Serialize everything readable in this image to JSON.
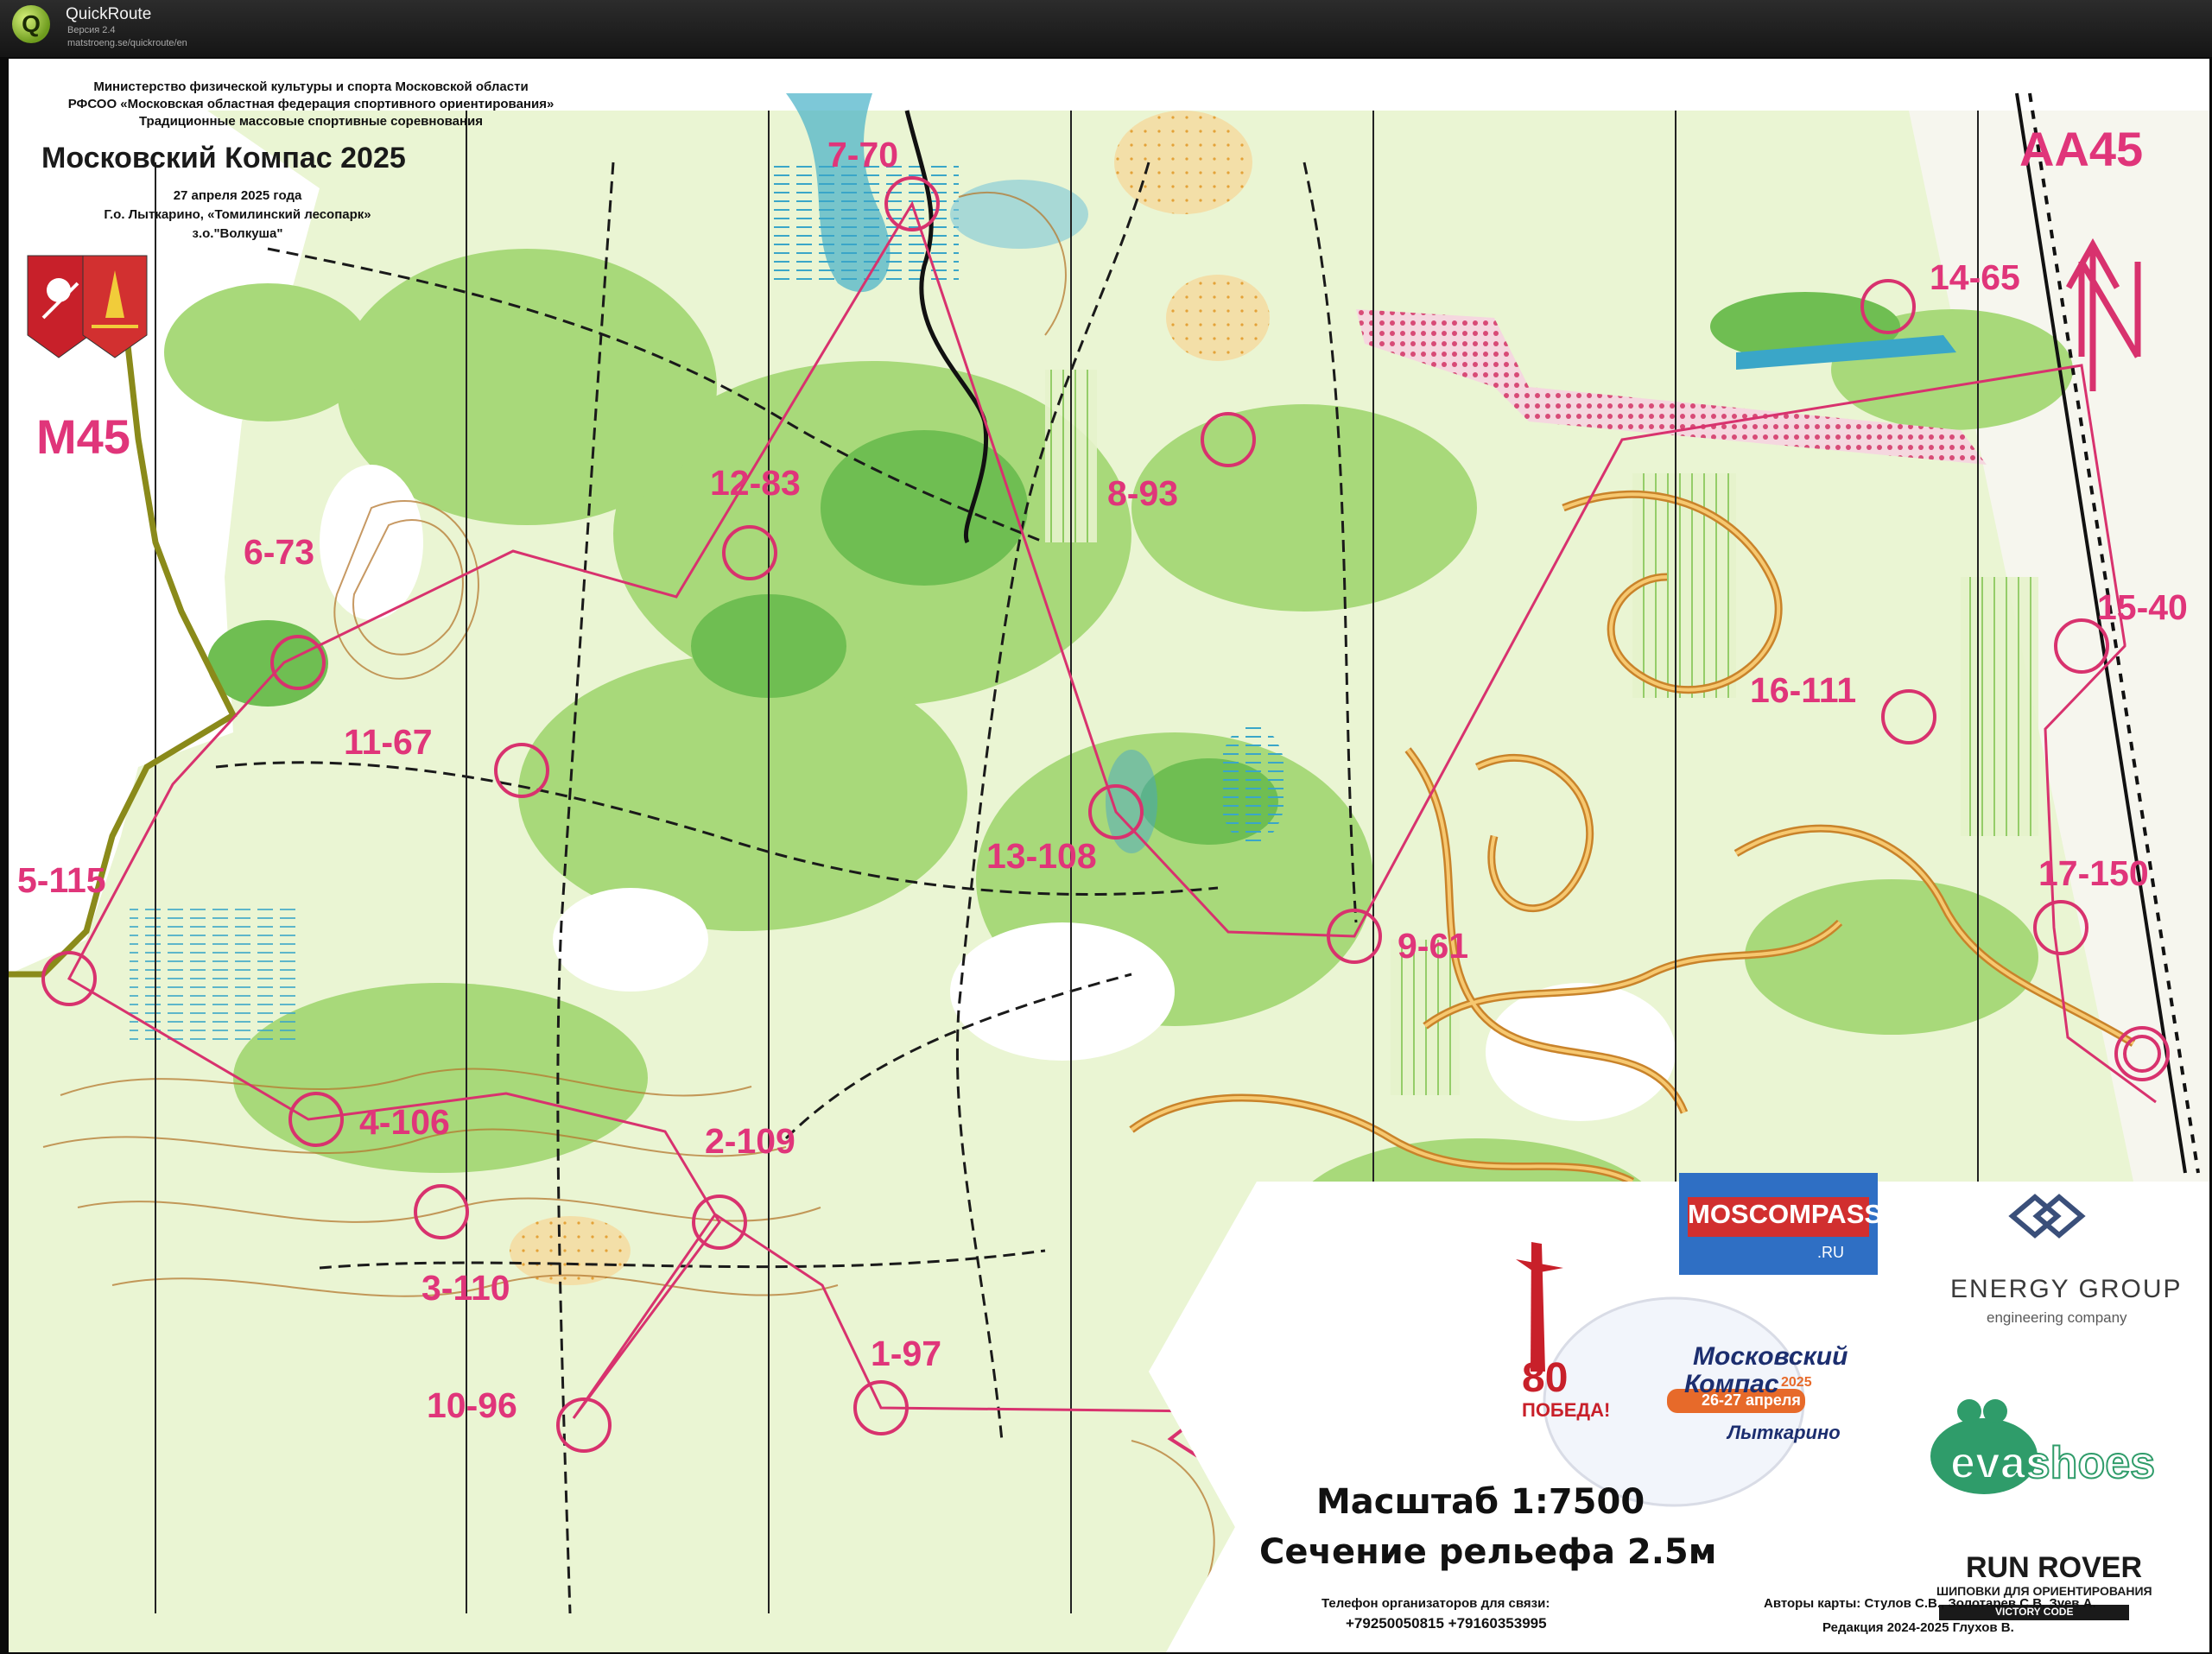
{
  "app": {
    "logo_letter": "Q",
    "name": "QuickRoute",
    "version": "Версия 2.4",
    "url": "matstroeng.se/quickroute/en"
  },
  "header": {
    "line1": "Министерство физической культуры и спорта Московской области",
    "line2": "РФСОО «Московская областная федерация спортивного ориентирования»",
    "line3": "Традиционные массовые спортивные соревнования",
    "title": "Московский Компас 2025",
    "date": "27 апреля 2025 года",
    "place": "Г.о. Лыткарино, «Томилинский лесопарк»",
    "zone": "з.о.\"Волкуша\""
  },
  "classes": {
    "left": "М45",
    "right": "АА45"
  },
  "controls": [
    {
      "label": "1-97"
    },
    {
      "label": "2-109"
    },
    {
      "label": "3-110"
    },
    {
      "label": "4-106"
    },
    {
      "label": "5-115"
    },
    {
      "label": "6-73"
    },
    {
      "label": "7-70"
    },
    {
      "label": "8-93"
    },
    {
      "label": "9-61"
    },
    {
      "label": "10-96"
    },
    {
      "label": "11-67"
    },
    {
      "label": "12-83"
    },
    {
      "label": "13-108"
    },
    {
      "label": "14-65"
    },
    {
      "label": "15-40"
    },
    {
      "label": "16-111"
    },
    {
      "label": "17-150"
    }
  ],
  "scale": {
    "line1": "Масштаб 1:7500",
    "line2": "Сечение рельефа 2.5м"
  },
  "contacts": {
    "label": "Телефон организаторов для связи:",
    "phones": "+79250050815  +79160353995"
  },
  "credits": {
    "authors": "Авторы карты: Стулов С.В., Золотарев С.В, Зуев А.",
    "edition": "Редакция 2024-2025  Глухов В."
  },
  "sponsors": {
    "moscompass": "MOSCOMPASS",
    "moscompass_ru": ".RU",
    "energy": "ENERGY GROUP",
    "energy_sub": "engineering company",
    "victory": "80",
    "victory_sub": "ПОБЕДА!",
    "event_logo_1": "Московский",
    "event_logo_2": "Компас",
    "event_logo_year": "2025",
    "event_logo_dates": "26-27 апреля",
    "event_logo_city": "Лыткарино",
    "eva": "evashoes",
    "runrover": "RUN ROVER",
    "runrover_sub": "ШИПОВКИ ДЛЯ ОРИЕНТИРОВАНИЯ",
    "runrover_tag": "VICTORY CODE"
  },
  "colors": {
    "course": "#d8326e",
    "forest_light": "#dff0bf",
    "forest": "#9bd36a",
    "forest_dark": "#62b447",
    "water": "#3aa6c8",
    "track": "#e4a238",
    "contour": "#b5782f"
  }
}
